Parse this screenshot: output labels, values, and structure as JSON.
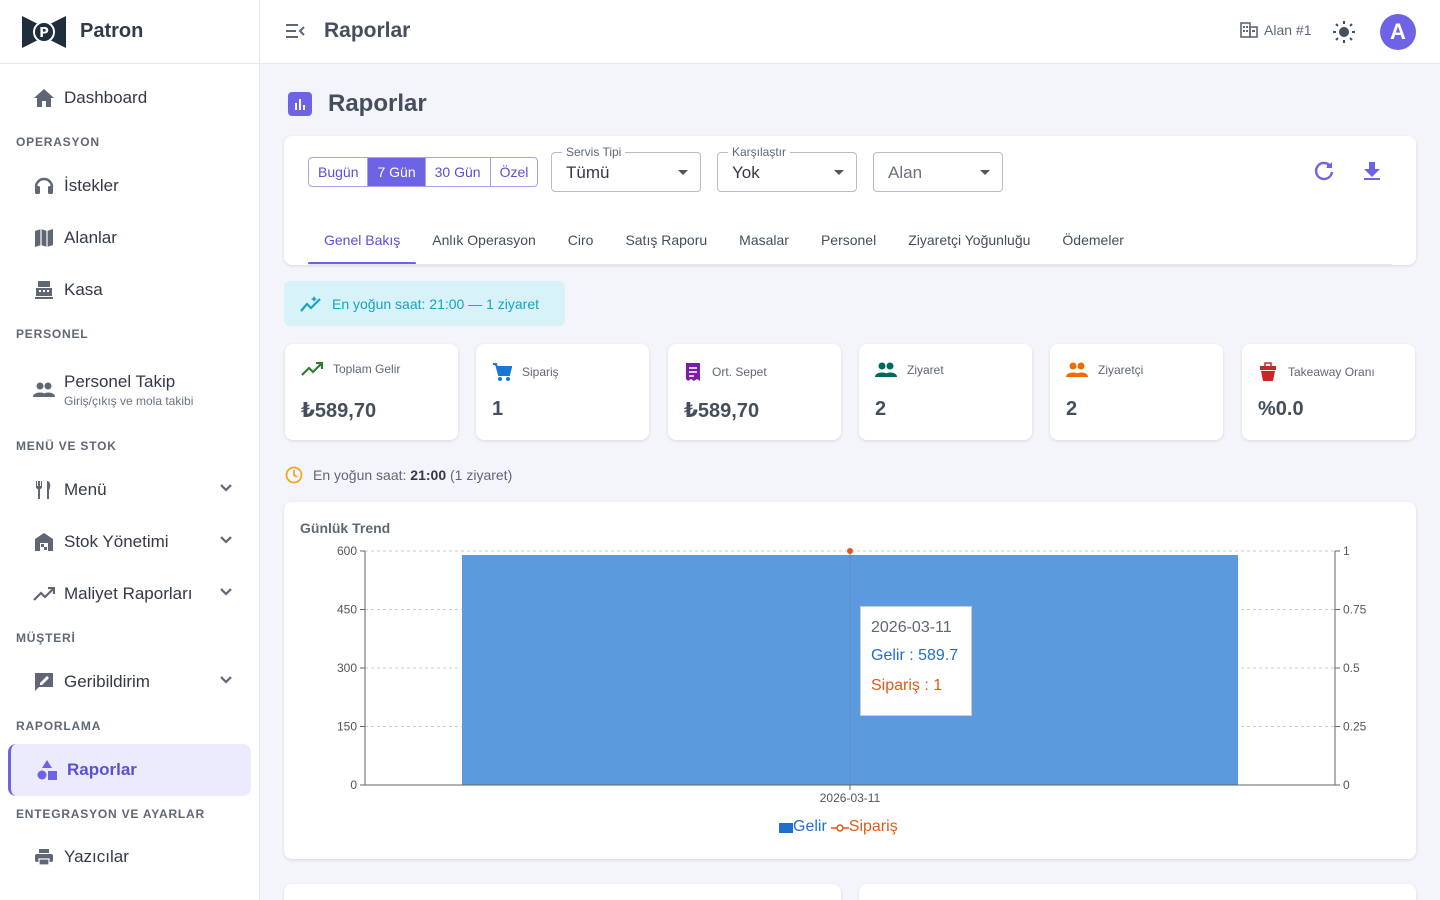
{
  "sidebar": {
    "brand": "Patron",
    "items": {
      "dashboard": "Dashboard",
      "istekler": "İstekler",
      "alanlar": "Alanlar",
      "kasa": "Kasa",
      "personel_takip": "Personel Takip",
      "personel_takip_sub": "Giriş/çıkış ve mola takibi",
      "menu": "Menü",
      "stok": "Stok Yönetimi",
      "maliyet": "Maliyet Raporları",
      "geribildirim": "Geribildirim",
      "raporlar": "Raporlar",
      "yazicilar": "Yazıcılar"
    },
    "sections": {
      "operasyon": "OPERASYON",
      "personel": "PERSONEL",
      "menu_stok": "MENÜ VE STOK",
      "musteri": "MÜŞTERİ",
      "raporlama": "RAPORLAMA",
      "entegrasyon": "ENTEGRASYON VE AYARLAR"
    }
  },
  "topbar": {
    "title": "Raporlar",
    "area": "Alan #1",
    "avatar": "A"
  },
  "page": {
    "title": "Raporlar"
  },
  "filters": {
    "ranges": [
      "Bugün",
      "7 Gün",
      "30 Gün",
      "Özel"
    ],
    "selected_range": "7 Gün",
    "servis_label": "Servis Tipi",
    "servis_value": "Tümü",
    "karsilastir_label": "Karşılaştır",
    "karsilastir_value": "Yok",
    "alan_placeholder": "Alan"
  },
  "tabs": [
    "Genel Bakış",
    "Anlık Operasyon",
    "Ciro",
    "Satış Raporu",
    "Masalar",
    "Personel",
    "Ziyaretçi Yoğunluğu",
    "Ödemeler"
  ],
  "active_tab": "Genel Bakış",
  "banner": "En yoğun saat: 21:00 — 1 ziyaret",
  "kpis": [
    {
      "label": "Toplam Gelir",
      "value": "₺589,70",
      "icon": "trending-up-icon",
      "color": "#2e7d32"
    },
    {
      "label": "Sipariş",
      "value": "1",
      "icon": "cart-icon",
      "color": "#1976d2"
    },
    {
      "label": "Ort. Sepet",
      "value": "₺589,70",
      "icon": "receipt-icon",
      "color": "#7b1fa2"
    },
    {
      "label": "Ziyaret",
      "value": "2",
      "icon": "people-icon",
      "color": "#00695c"
    },
    {
      "label": "Ziyaretçi",
      "value": "2",
      "icon": "people-icon",
      "color": "#ef6c00"
    },
    {
      "label": "Takeaway Oranı",
      "value": "%0.0",
      "icon": "takeaway-icon",
      "color": "#c62828"
    }
  ],
  "peak": {
    "prefix": "En yoğun saat:",
    "hour": "21:00",
    "suffix": "(1 ziyaret)"
  },
  "chart_data": {
    "type": "bar",
    "title": "Günlük Trend",
    "categories": [
      "2026-03-11"
    ],
    "series": [
      {
        "name": "Gelir",
        "type": "bar",
        "values": [
          589.7
        ],
        "axis": "left",
        "color": "#5b9bdd"
      },
      {
        "name": "Sipariş",
        "type": "line",
        "values": [
          1
        ],
        "axis": "right",
        "color": "#e05a17"
      }
    ],
    "ylim_left": [
      0,
      600
    ],
    "yticks_left": [
      "0",
      "150",
      "300",
      "450",
      "600"
    ],
    "ylim_right": [
      0,
      1
    ],
    "yticks_right": [
      "0",
      "0.25",
      "0.5",
      "0.75",
      "1"
    ],
    "legend": "bottom-center",
    "grid": true
  },
  "tooltip": {
    "date": "2026-03-11",
    "gelir": "Gelir : 589.7",
    "siparis": "Sipariş : 1"
  },
  "colors": {
    "primary": "#6e63e5",
    "info": "#16a4c2"
  }
}
